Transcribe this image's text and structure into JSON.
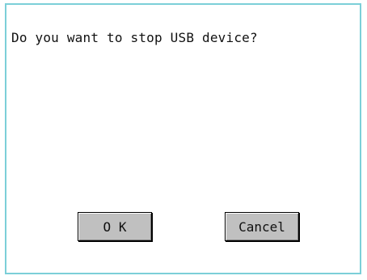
{
  "dialog": {
    "message": "Do you want to stop USB device?",
    "ok_label": "O K",
    "cancel_label": "Cancel",
    "border_color": "#7ccfd8",
    "button_color": "#c0c0c0"
  }
}
